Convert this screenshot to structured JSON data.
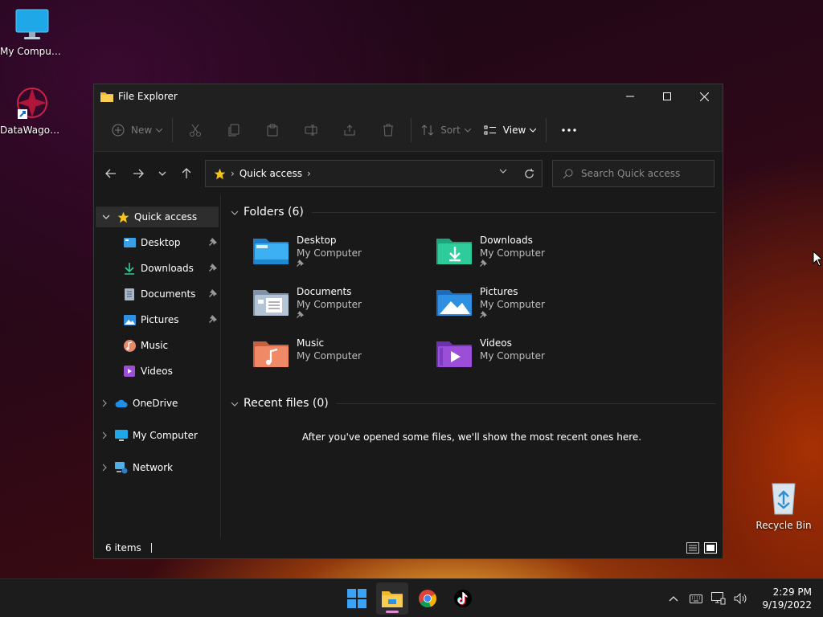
{
  "desktop": {
    "icons": [
      {
        "label": "My Computer"
      },
      {
        "label": "DataWagon..."
      },
      {
        "label": "Recycle Bin"
      }
    ]
  },
  "window": {
    "title": "File Explorer"
  },
  "toolbar": {
    "new_label": "New",
    "sort_label": "Sort",
    "view_label": "View"
  },
  "address": {
    "segment": "Quick access"
  },
  "search": {
    "placeholder": "Search Quick access"
  },
  "sidebar": {
    "quick_access": "Quick access",
    "pinned": [
      {
        "label": "Desktop"
      },
      {
        "label": "Downloads"
      },
      {
        "label": "Documents"
      },
      {
        "label": "Pictures"
      },
      {
        "label": "Music"
      },
      {
        "label": "Videos"
      }
    ],
    "onedrive": "OneDrive",
    "my_computer": "My Computer",
    "network": "Network"
  },
  "content": {
    "folders_header": "Folders (6)",
    "folders": [
      {
        "name": "Desktop",
        "location": "My Computer"
      },
      {
        "name": "Downloads",
        "location": "My Computer"
      },
      {
        "name": "Documents",
        "location": "My Computer"
      },
      {
        "name": "Pictures",
        "location": "My Computer"
      },
      {
        "name": "Music",
        "location": "My Computer"
      },
      {
        "name": "Videos",
        "location": "My Computer"
      }
    ],
    "recent_header": "Recent files (0)",
    "recent_empty": "After you've opened some files, we'll show the most recent ones here."
  },
  "status": {
    "item_count": "6 items"
  },
  "clock": {
    "time": "2:29 PM",
    "date": "9/19/2022"
  }
}
